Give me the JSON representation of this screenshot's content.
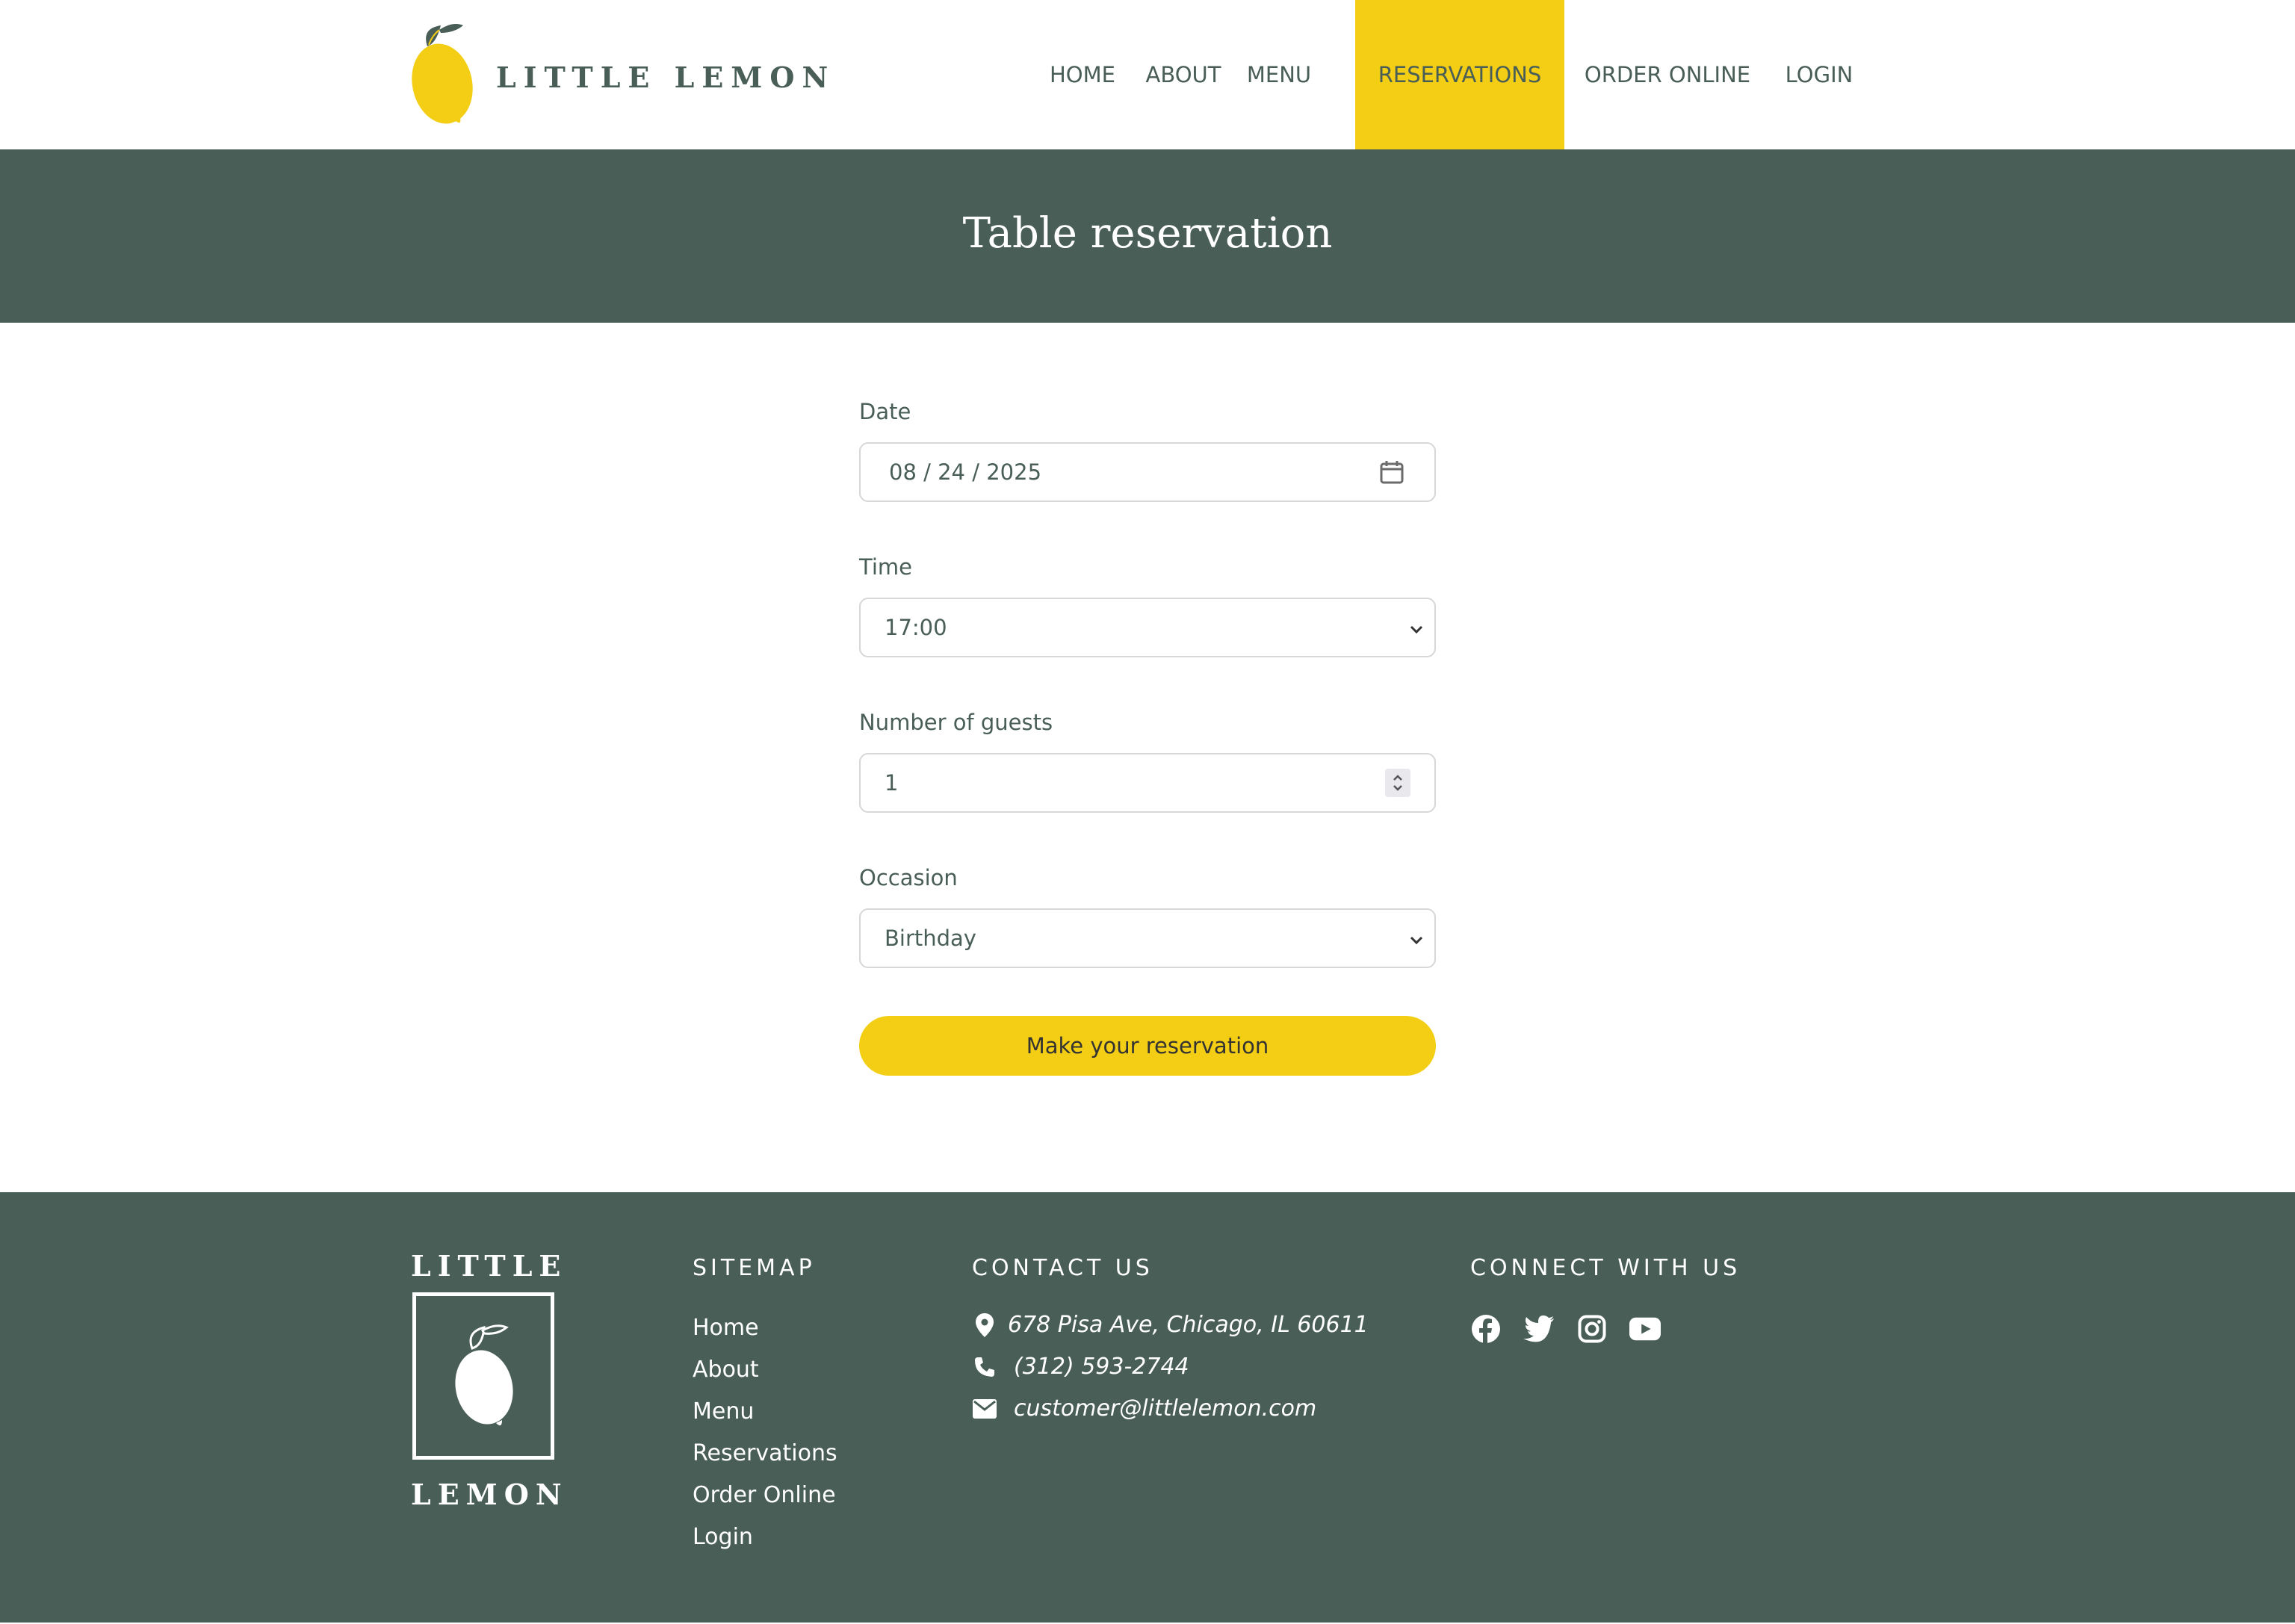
{
  "brand": {
    "name": "LITTLE LEMON",
    "colors": {
      "primary_green": "#495e57",
      "accent_yellow": "#f4ce14",
      "white": "#ffffff"
    }
  },
  "nav": {
    "items": [
      {
        "label": "HOME",
        "active": false
      },
      {
        "label": "ABOUT",
        "active": false
      },
      {
        "label": "MENU",
        "active": false
      },
      {
        "label": "RESERVATIONS",
        "active": true
      },
      {
        "label": "ORDER ONLINE",
        "active": false
      },
      {
        "label": "LOGIN",
        "active": false
      }
    ]
  },
  "hero": {
    "title": "Table reservation"
  },
  "form": {
    "date": {
      "label": "Date",
      "value": "08 / 24 / 2025",
      "icon": "calendar-icon"
    },
    "time": {
      "label": "Time",
      "value": "17:00",
      "icon": "chevron-down-icon"
    },
    "guests": {
      "label": "Number of guests",
      "value": "1",
      "icon": "stepper-icon"
    },
    "occasion": {
      "label": "Occasion",
      "value": "Birthday",
      "icon": "chevron-down-icon"
    },
    "submit_label": "Make your reservation"
  },
  "footer": {
    "logo_top": "LITTLE",
    "logo_bottom": "LEMON",
    "sitemap": {
      "heading": "SITEMAP",
      "links": [
        "Home",
        "About",
        "Menu",
        "Reservations",
        "Order Online",
        "Login"
      ]
    },
    "contact": {
      "heading": "CONTACT US",
      "address": "678 Pisa Ave, Chicago, IL 60611",
      "phone": "(312) 593-2744",
      "email": "customer@littlelemon.com"
    },
    "connect": {
      "heading": "CONNECT WITH US",
      "socials": [
        "facebook-icon",
        "twitter-icon",
        "instagram-icon",
        "youtube-icon"
      ]
    }
  }
}
